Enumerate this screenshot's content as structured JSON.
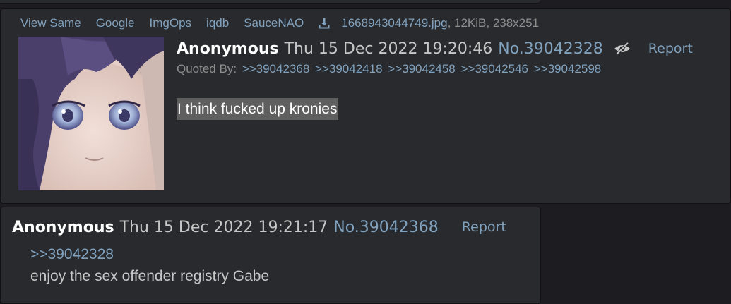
{
  "post1": {
    "file_links": [
      "View Same",
      "Google",
      "ImgOps",
      "iqdb",
      "SauceNAO"
    ],
    "download_icon": "download-icon",
    "file_name": "1668943044749.jpg",
    "file_meta": ", 12KiB, 238x251",
    "name": "Anonymous",
    "date": "Thu 15 Dec 2022 19:20:46",
    "post_no": "No.39042328",
    "hide_icon": "eye-slash-icon",
    "report": "Report",
    "quoted_by_label": "Quoted By:",
    "quoted_by": [
      ">>39042368",
      ">>39042418",
      ">>39042458",
      ">>39042546",
      ">>39042598"
    ],
    "message": "I think fucked up kronies"
  },
  "post2": {
    "name": "Anonymous",
    "date": "Thu 15 Dec 2022 19:21:17",
    "post_no": "No.39042368",
    "report": "Report",
    "quote_link": ">>39042328",
    "message": "enjoy the sex offender registry Gabe"
  },
  "colors": {
    "background": "#1d1d21",
    "post_bg": "#282a2e",
    "link": "#81a2be",
    "text": "#c5c8c6",
    "name": "#ffffff",
    "highlight": "#5f5f5f"
  }
}
